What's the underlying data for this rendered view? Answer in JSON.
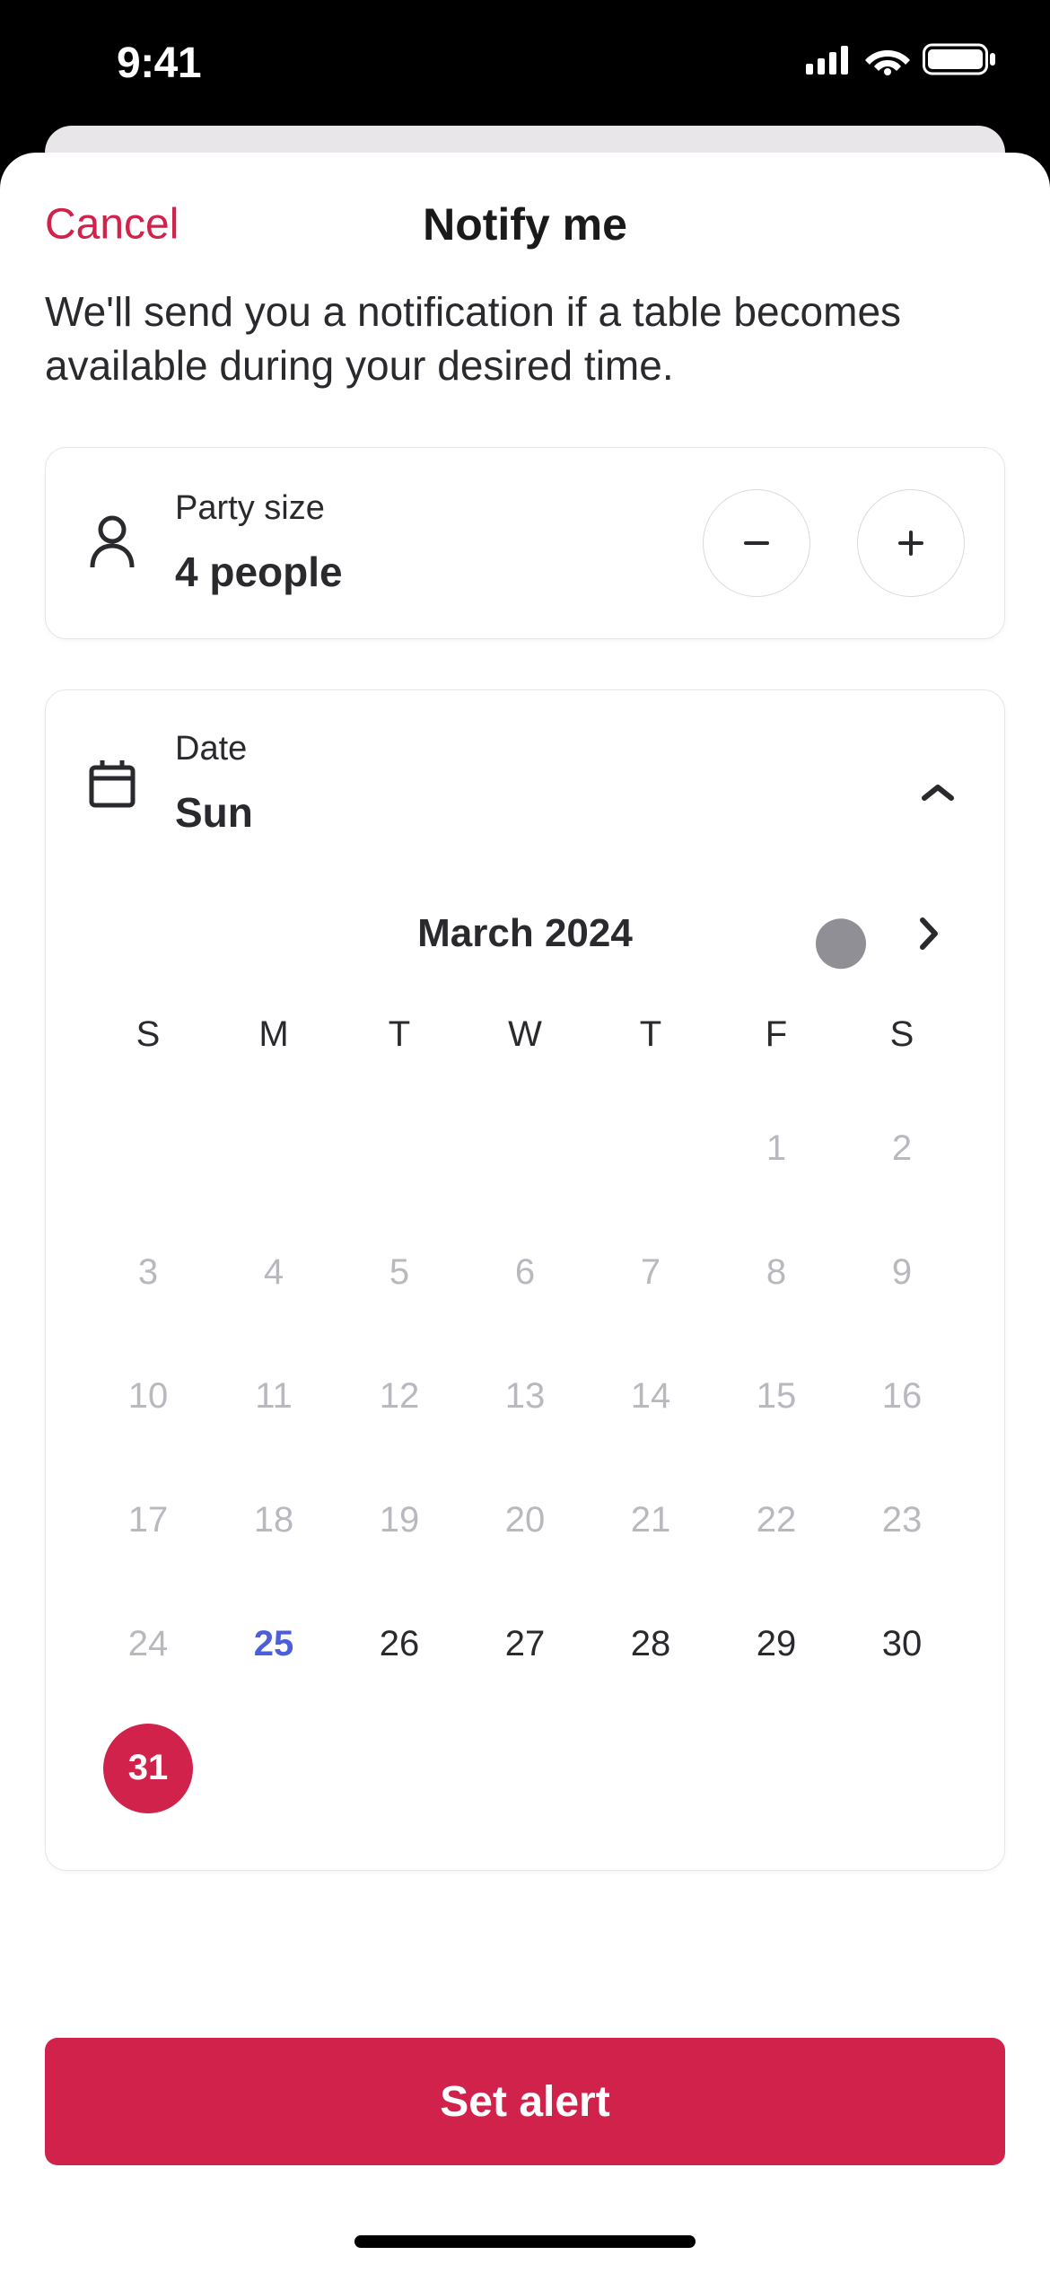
{
  "status": {
    "time": "9:41"
  },
  "header": {
    "cancel": "Cancel",
    "title": "Notify me"
  },
  "description": "We'll send you a notification if a table becomes available during your desired time.",
  "party": {
    "label": "Party size",
    "value": "4 people"
  },
  "date": {
    "label": "Date",
    "value": "Sun",
    "month": "March 2024",
    "weekdays": [
      "S",
      "M",
      "T",
      "W",
      "T",
      "F",
      "S"
    ],
    "weeks": [
      [
        {
          "n": "",
          "state": "empty"
        },
        {
          "n": "",
          "state": "empty"
        },
        {
          "n": "",
          "state": "empty"
        },
        {
          "n": "",
          "state": "empty"
        },
        {
          "n": "",
          "state": "empty"
        },
        {
          "n": "1",
          "state": "past"
        },
        {
          "n": "2",
          "state": "past"
        }
      ],
      [
        {
          "n": "3",
          "state": "past"
        },
        {
          "n": "4",
          "state": "past"
        },
        {
          "n": "5",
          "state": "past"
        },
        {
          "n": "6",
          "state": "past"
        },
        {
          "n": "7",
          "state": "past"
        },
        {
          "n": "8",
          "state": "past"
        },
        {
          "n": "9",
          "state": "past"
        }
      ],
      [
        {
          "n": "10",
          "state": "past"
        },
        {
          "n": "11",
          "state": "past"
        },
        {
          "n": "12",
          "state": "past"
        },
        {
          "n": "13",
          "state": "past"
        },
        {
          "n": "14",
          "state": "past"
        },
        {
          "n": "15",
          "state": "past"
        },
        {
          "n": "16",
          "state": "past"
        }
      ],
      [
        {
          "n": "17",
          "state": "past"
        },
        {
          "n": "18",
          "state": "past"
        },
        {
          "n": "19",
          "state": "past"
        },
        {
          "n": "20",
          "state": "past"
        },
        {
          "n": "21",
          "state": "past"
        },
        {
          "n": "22",
          "state": "past"
        },
        {
          "n": "23",
          "state": "past"
        }
      ],
      [
        {
          "n": "24",
          "state": "past"
        },
        {
          "n": "25",
          "state": "today"
        },
        {
          "n": "26",
          "state": "active"
        },
        {
          "n": "27",
          "state": "active"
        },
        {
          "n": "28",
          "state": "active"
        },
        {
          "n": "29",
          "state": "active"
        },
        {
          "n": "30",
          "state": "active"
        }
      ],
      [
        {
          "n": "31",
          "state": "selected"
        },
        {
          "n": "",
          "state": "empty"
        },
        {
          "n": "",
          "state": "empty"
        },
        {
          "n": "",
          "state": "empty"
        },
        {
          "n": "",
          "state": "empty"
        },
        {
          "n": "",
          "state": "empty"
        },
        {
          "n": "",
          "state": "empty"
        }
      ]
    ]
  },
  "cta": "Set alert",
  "colors": {
    "accent": "#d0224a"
  }
}
